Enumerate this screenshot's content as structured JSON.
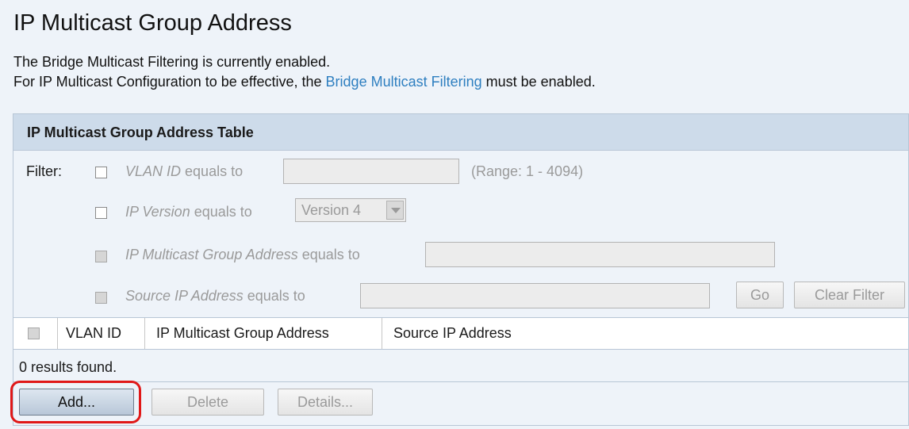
{
  "page": {
    "title": "IP Multicast Group Address",
    "message_line1": "The Bridge Multicast Filtering is currently enabled.",
    "message_line2_prefix": "For IP Multicast Configuration to be effective, the ",
    "message_line2_link": "Bridge Multicast Filtering",
    "message_line2_suffix": " must be enabled."
  },
  "panel": {
    "title": "IP Multicast Group Address Table"
  },
  "filter": {
    "label": "Filter:",
    "vlan": {
      "field": "VLAN ID",
      "suffix": " equals to",
      "value": "",
      "range": "(Range: 1 - 4094)",
      "checked": false
    },
    "ip_version": {
      "field": "IP Version",
      "suffix": " equals to",
      "selected": "Version 4",
      "checked": false
    },
    "group_address": {
      "field": "IP Multicast Group Address",
      "suffix": " equals to",
      "value": "",
      "checked": false
    },
    "source_ip": {
      "field": "Source IP Address",
      "suffix": " equals to",
      "value": "",
      "checked": false
    },
    "go_label": "Go",
    "clear_label": "Clear Filter"
  },
  "table": {
    "columns": [
      "VLAN ID",
      "IP Multicast Group Address",
      "Source IP Address"
    ],
    "rows": [],
    "results_text": "0 results found."
  },
  "actions": {
    "add_label": "Add...",
    "delete_label": "Delete",
    "details_label": "Details..."
  },
  "colors": {
    "link": "#2e7fc0",
    "highlight": "#e01818",
    "header_bg": "#cddbea"
  }
}
